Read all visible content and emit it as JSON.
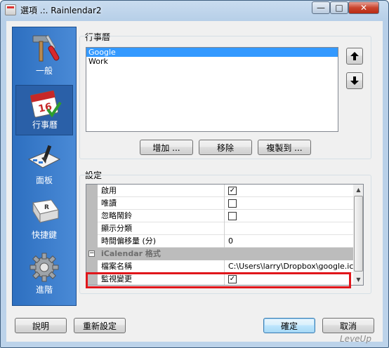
{
  "window": {
    "title": "選項 .:. Rainlendar2",
    "controls": {
      "minimize": "—",
      "maximize": "□",
      "close": "✕"
    }
  },
  "sidebar": {
    "items": [
      {
        "label": "一般",
        "icon": "hammer-screwdriver-icon",
        "selected": false
      },
      {
        "label": "行事曆",
        "icon": "calendar-icon",
        "selected": true
      },
      {
        "label": "面板",
        "icon": "skin-brush-icon",
        "selected": false
      },
      {
        "label": "快捷鍵",
        "icon": "keyboard-key-icon",
        "selected": false
      },
      {
        "label": "進階",
        "icon": "gear-icon",
        "selected": false
      }
    ]
  },
  "calendars": {
    "group_title": "行事曆",
    "items": [
      "Google",
      "Work"
    ],
    "selected_index": 0,
    "buttons": {
      "add": "增加 ...",
      "remove": "移除",
      "copy": "複製到 ..."
    },
    "move_up_icon": "arrow-up-icon",
    "move_down_icon": "arrow-down-icon"
  },
  "settings": {
    "group_title": "設定",
    "rows": [
      {
        "name": "啟用",
        "type": "checkbox",
        "checked": true
      },
      {
        "name": "唯讀",
        "type": "checkbox",
        "checked": false
      },
      {
        "name": "忽略鬧鈴",
        "type": "checkbox",
        "checked": false
      },
      {
        "name": "顯示分類",
        "type": "text",
        "value": ""
      },
      {
        "name": "時間偏移量 (分)",
        "type": "text",
        "value": "0"
      }
    ],
    "category": {
      "toggle": "−",
      "label": "iCalendar 格式"
    },
    "category_rows": [
      {
        "name": "檔案名稱",
        "type": "text",
        "value": "C:\\Users\\larry\\Dropbox\\google.ics"
      },
      {
        "name": "監視變更",
        "type": "checkbox",
        "checked": true
      }
    ],
    "highlight_color": "#e0161b"
  },
  "footer": {
    "help": "說明",
    "reset": "重新設定",
    "ok": "確定",
    "cancel": "取消"
  },
  "watermark": "LeveUp"
}
